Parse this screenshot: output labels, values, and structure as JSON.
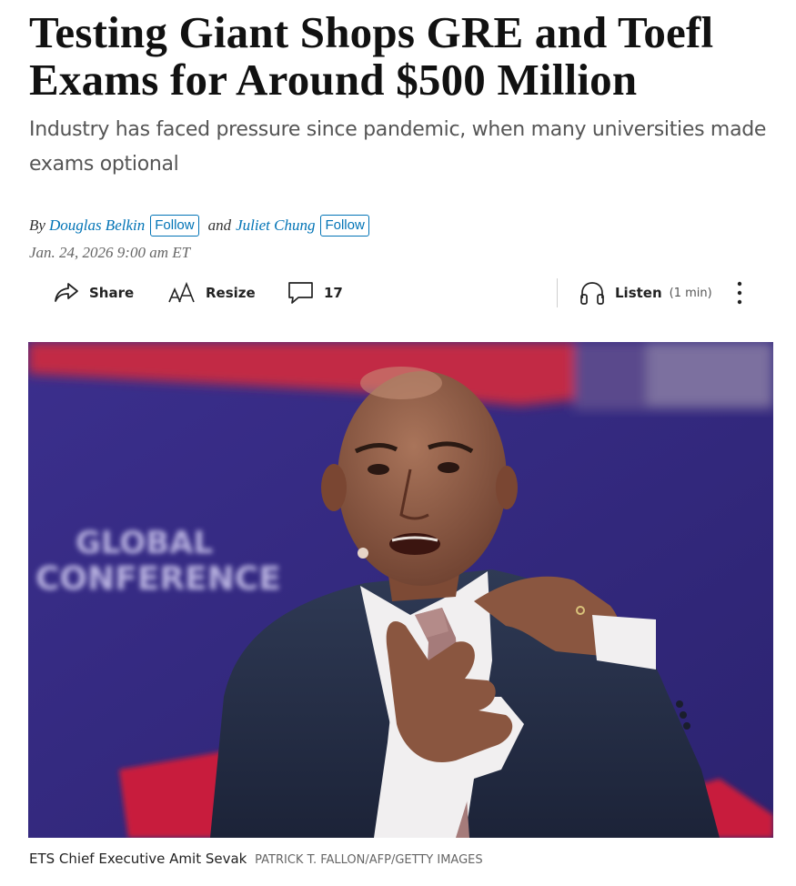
{
  "article": {
    "headline": "Testing Giant Shops GRE and Toefl Exams for Around $500 Million",
    "dek": "Industry has faced pressure since pandemic, when many universities made exams optional",
    "byline": {
      "prefix": "By",
      "authors": [
        {
          "name": "Douglas Belkin",
          "follow_label": "Follow"
        },
        {
          "name": "Juliet Chung",
          "follow_label": "Follow"
        }
      ],
      "conjunction": "and"
    },
    "date": "Jan. 24, 2026 9:00 am ET"
  },
  "toolbar": {
    "share_label": "Share",
    "resize_label": "Resize",
    "comment_count": "17",
    "listen_label": "Listen",
    "listen_duration": "(1 min)"
  },
  "photo": {
    "backdrop_text_line1": "GLOBAL",
    "backdrop_text_line2": "CONFERENCE",
    "caption": "ETS Chief Executive Amit Sevak",
    "credit": "PATRICK T. FALLON/AFP/GETTY IMAGES"
  },
  "icons": {
    "share": "share-arrow-icon",
    "resize": "text-resize-icon",
    "comments": "speech-bubble-icon",
    "listen": "headphones-icon",
    "more": "vertical-ellipsis-icon"
  },
  "colors": {
    "link": "#0274b6",
    "headline": "#111111",
    "dek": "#555555",
    "backdrop_purple": "#3a2f8a",
    "backdrop_red": "#c8283a"
  }
}
